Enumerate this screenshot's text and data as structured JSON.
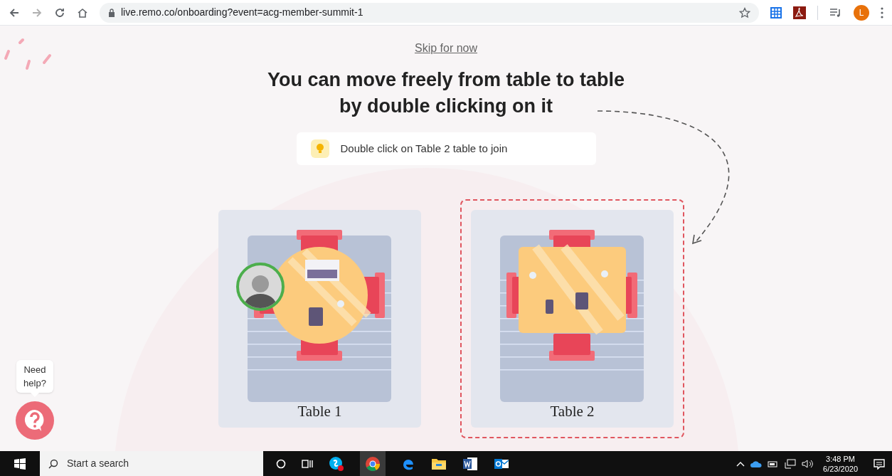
{
  "browser": {
    "url": "live.remo.co/onboarding?event=acg-member-summit-1",
    "profile_initial": "L"
  },
  "skip_link": "Skip for now",
  "heading_lines": [
    "You can move freely from table to table",
    "by double clicking on it"
  ],
  "hint": "Double click on Table 2 table to join",
  "tables": [
    {
      "label": "Table 1",
      "kind": "round",
      "selected": false,
      "occupied": true
    },
    {
      "label": "Table 2",
      "kind": "square",
      "selected": true,
      "occupied": false
    }
  ],
  "help": {
    "tooltip": "Need help?"
  },
  "taskbar": {
    "search_placeholder": "Start a search",
    "time": "3:48 PM",
    "date": "6/23/2020"
  }
}
